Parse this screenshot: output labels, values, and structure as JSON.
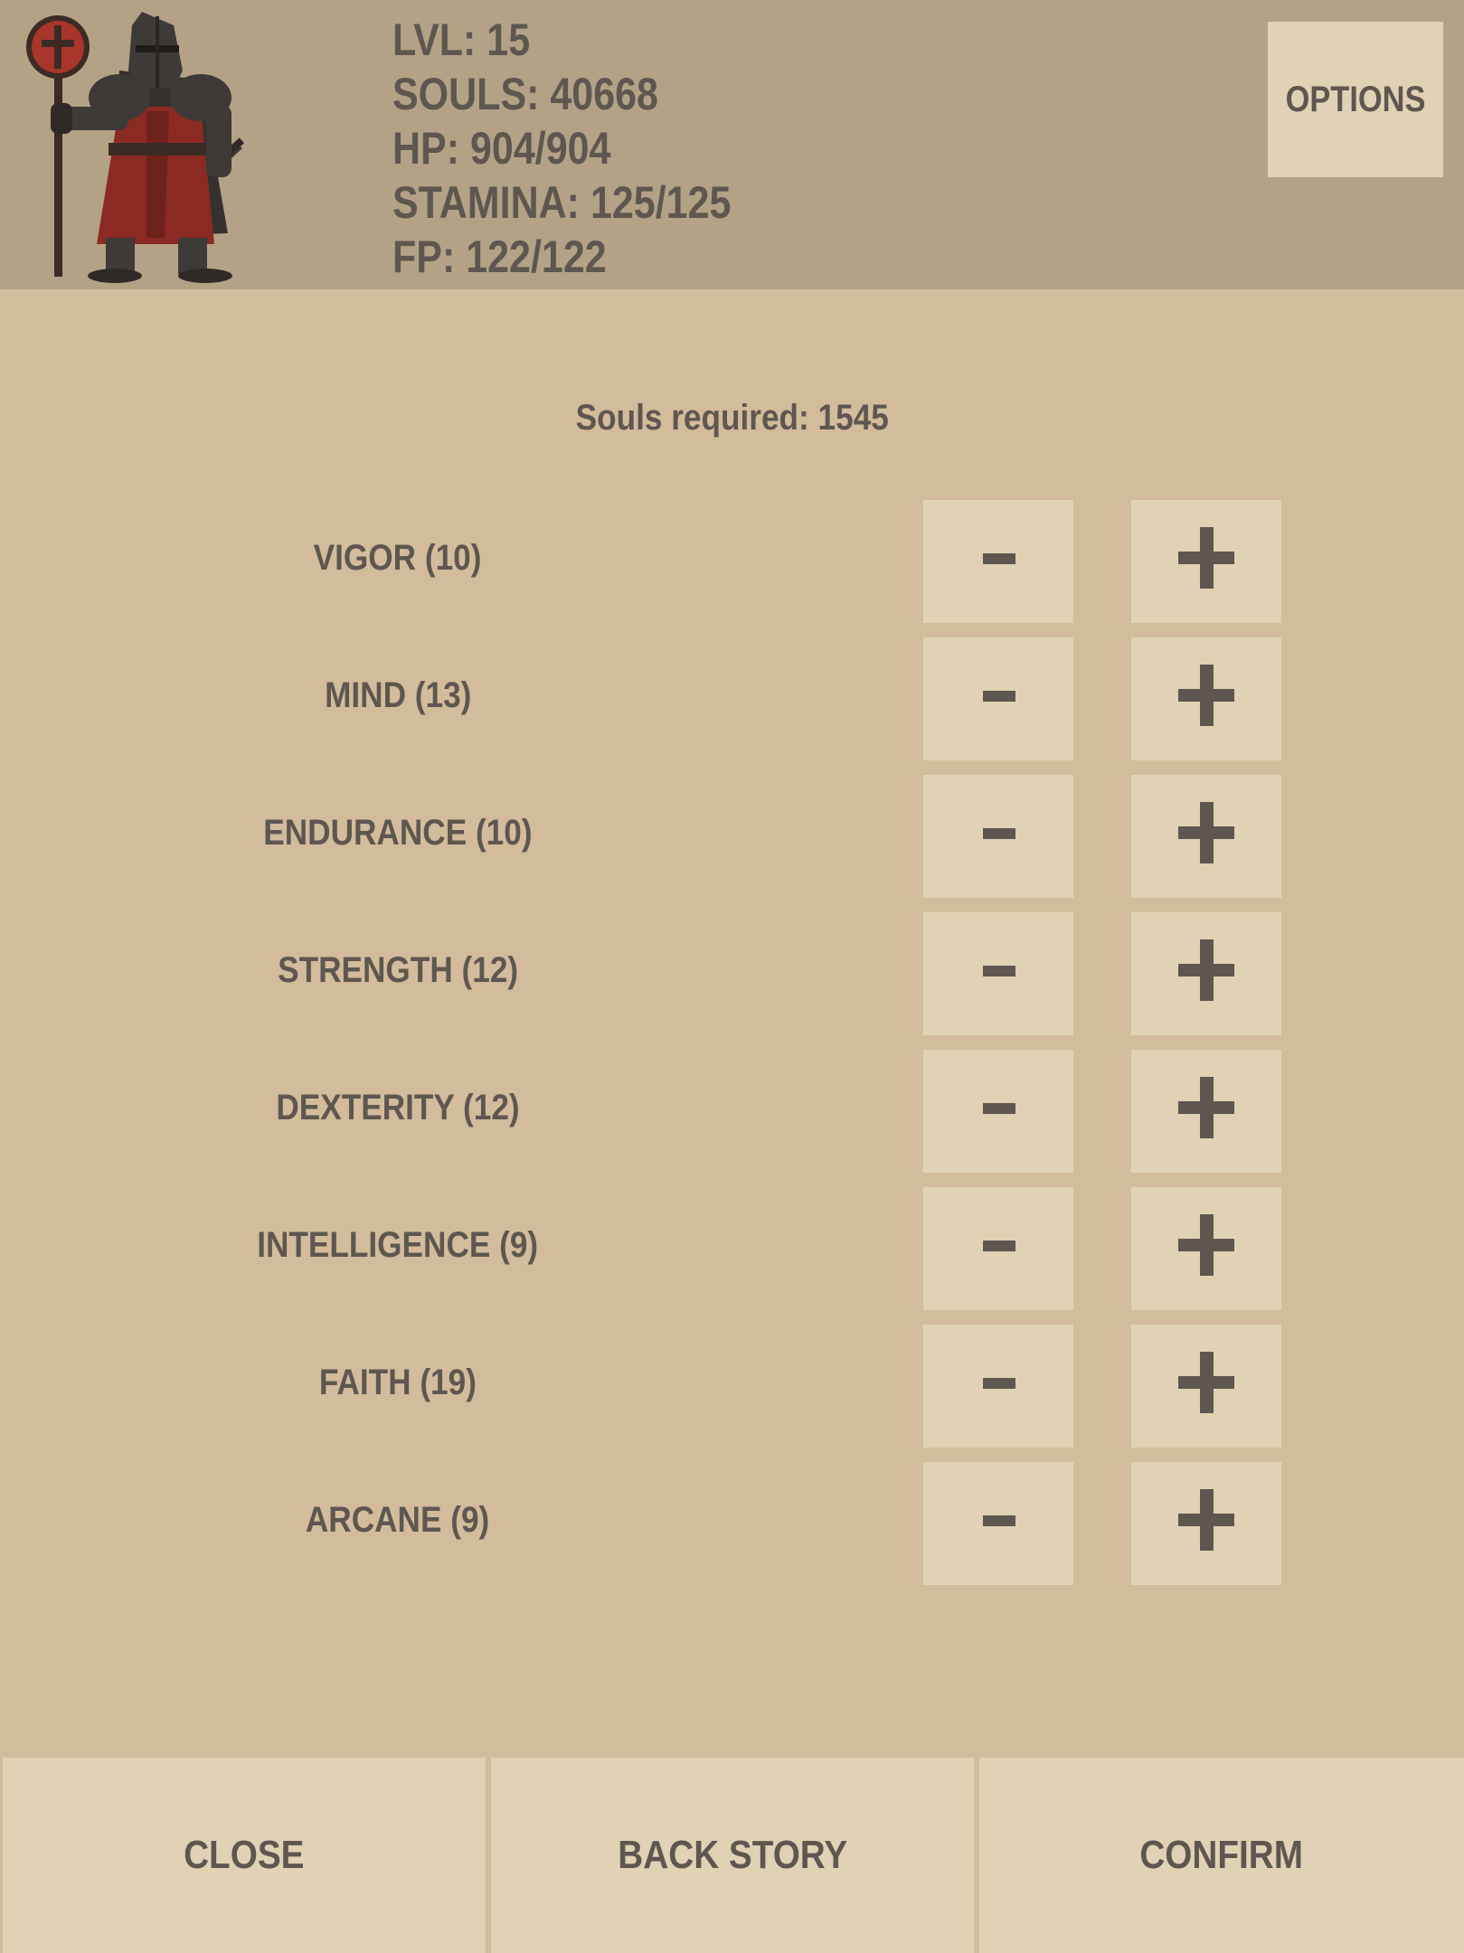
{
  "colors": {
    "header_bg": "#b3a286",
    "page_bg": "#d3bc9b",
    "button_bg": "#e1d2b5",
    "text": "#5e5750",
    "tunic_red": "#8b2a22"
  },
  "character": {
    "portrait_icon": "knight-portrait-icon"
  },
  "stats": {
    "level": "LVL: 15",
    "souls": "SOULS: 40668",
    "hp": "HP: 904/904",
    "stamina": "STAMINA: 125/125",
    "fp": "FP: 122/122"
  },
  "header": {
    "options_label": "OPTIONS"
  },
  "level_up": {
    "souls_required": "Souls required: 1545",
    "attributes": [
      {
        "label": "VIGOR (10)",
        "minus": "-",
        "plus": "+"
      },
      {
        "label": "MIND (13)",
        "minus": "-",
        "plus": "+"
      },
      {
        "label": "ENDURANCE (10)",
        "minus": "-",
        "plus": "+"
      },
      {
        "label": "STRENGTH (12)",
        "minus": "-",
        "plus": "+"
      },
      {
        "label": "DEXTERITY (12)",
        "minus": "-",
        "plus": "+"
      },
      {
        "label": "INTELLIGENCE (9)",
        "minus": "-",
        "plus": "+"
      },
      {
        "label": "FAITH (19)",
        "minus": "-",
        "plus": "+"
      },
      {
        "label": "ARCANE (9)",
        "minus": "-",
        "plus": "+"
      }
    ]
  },
  "footer": {
    "close_label": "CLOSE",
    "backstory_label": "BACK STORY",
    "confirm_label": "CONFIRM"
  }
}
